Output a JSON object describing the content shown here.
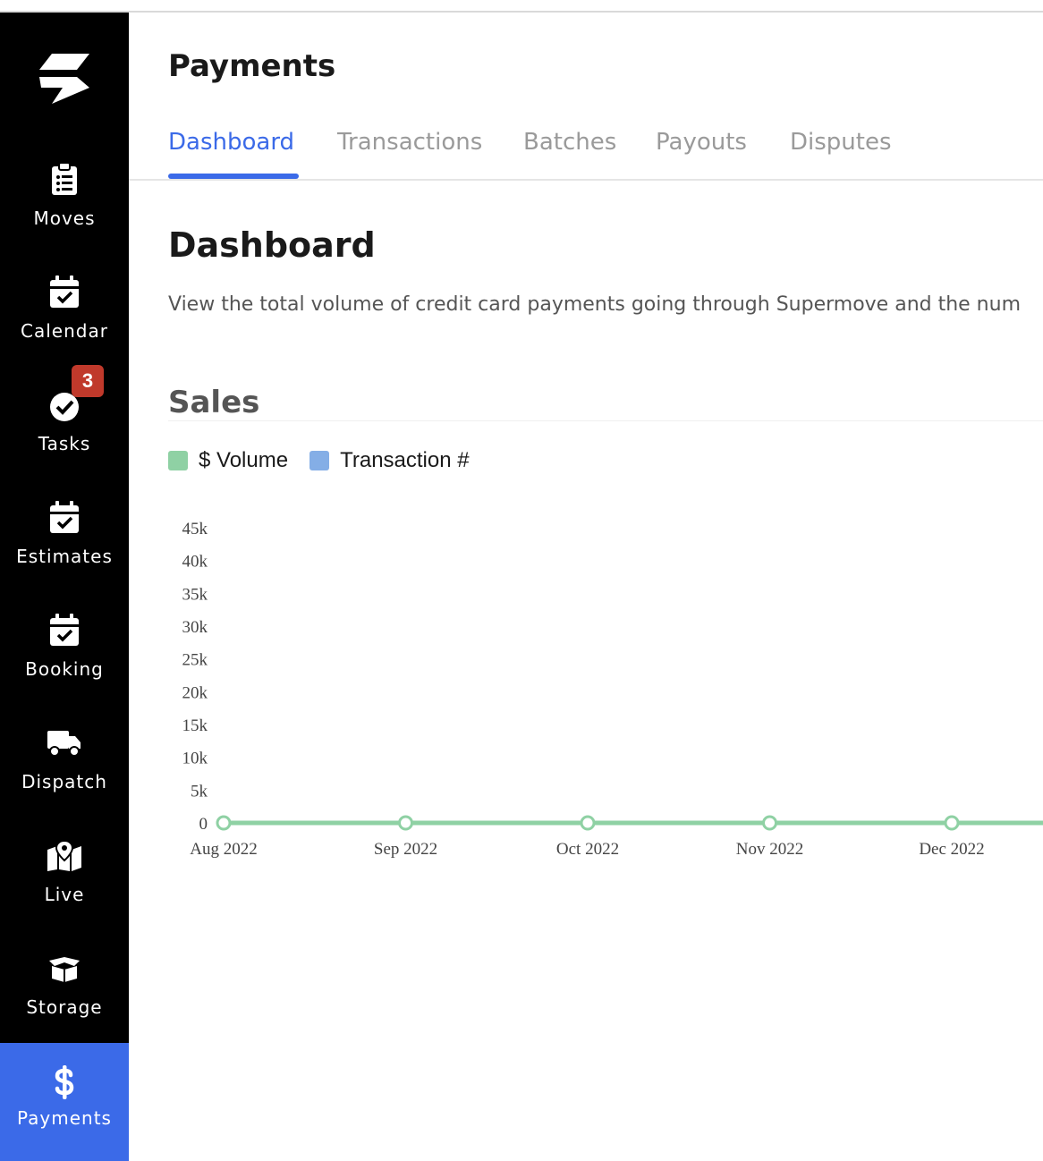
{
  "sidebar": {
    "items": [
      {
        "label": "Moves",
        "icon": "clipboard-list-icon"
      },
      {
        "label": "Calendar",
        "icon": "calendar-check-icon"
      },
      {
        "label": "Tasks",
        "icon": "check-circle-icon",
        "badge": "3"
      },
      {
        "label": "Estimates",
        "icon": "calendar-check-icon"
      },
      {
        "label": "Booking",
        "icon": "calendar-check-icon"
      },
      {
        "label": "Dispatch",
        "icon": "truck-icon"
      },
      {
        "label": "Live",
        "icon": "map-marker-icon"
      },
      {
        "label": "Storage",
        "icon": "box-open-icon"
      },
      {
        "label": "Payments",
        "icon": "dollar-sign-icon",
        "active": true
      }
    ]
  },
  "header": {
    "title": "Payments"
  },
  "tabs": [
    {
      "label": "Dashboard",
      "active": true
    },
    {
      "label": "Transactions"
    },
    {
      "label": "Batches"
    },
    {
      "label": "Payouts"
    },
    {
      "label": "Disputes"
    }
  ],
  "dashboard": {
    "title": "Dashboard",
    "description": "View the total volume of credit card payments going through Supermove and the num"
  },
  "sales": {
    "title": "Sales",
    "legend": [
      {
        "label": "$ Volume",
        "color": "#8fd1a4"
      },
      {
        "label": "Transaction #",
        "color": "#84aee6"
      }
    ]
  },
  "colors": {
    "accent": "#3b6ae8",
    "sidebar_bg": "#000000",
    "badge": "#c0392b",
    "volume_line": "#8fd1a4"
  },
  "chart_data": {
    "type": "line",
    "x": [
      "Aug 2022",
      "Sep 2022",
      "Oct 2022",
      "Nov 2022",
      "Dec 2022"
    ],
    "series": [
      {
        "name": "$ Volume",
        "values": [
          0,
          0,
          0,
          0,
          0
        ]
      }
    ],
    "y_ticks": [
      "0",
      "5k",
      "10k",
      "15k",
      "20k",
      "25k",
      "30k",
      "35k",
      "40k",
      "45k"
    ],
    "ylim": [
      0,
      45000
    ],
    "title": "",
    "xlabel": "",
    "ylabel": "",
    "legend": "top-left"
  }
}
